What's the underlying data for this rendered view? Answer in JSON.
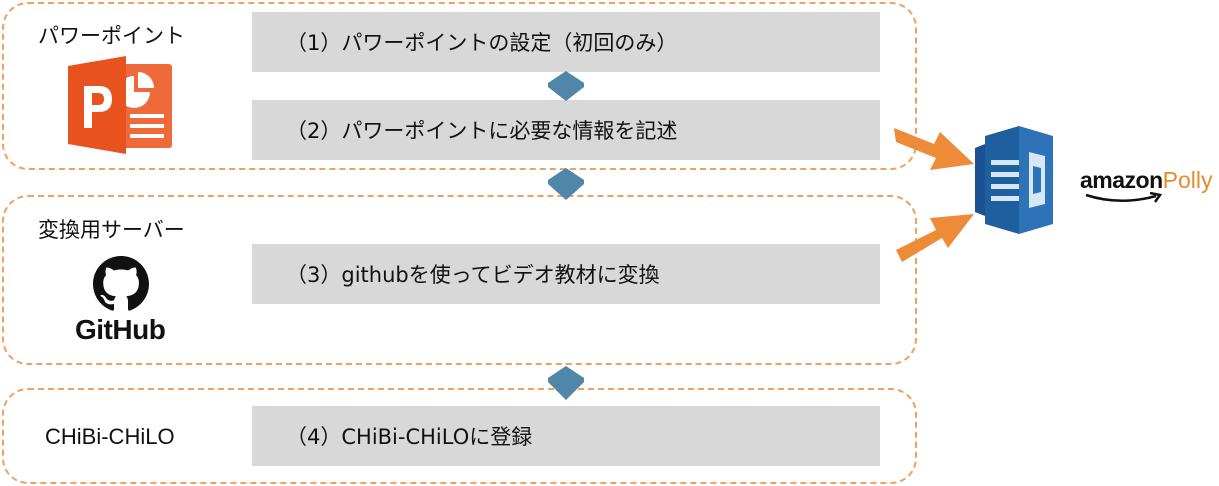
{
  "groups": [
    {
      "label": "パワーポイント",
      "icon": "powerpoint-logo-icon"
    },
    {
      "label": "変換用サーバー",
      "icon": "github-logo-icon",
      "logo_text": "GitHub"
    },
    {
      "label": "CHiBi-CHiLO"
    }
  ],
  "steps": [
    {
      "text": "（1）パワーポイントの設定（初回のみ）"
    },
    {
      "text": "（2）パワーポイントに必要な情報を記述"
    },
    {
      "text": "（3）githubを使ってビデオ教材に変換"
    },
    {
      "text": "（4）CHiBi-CHiLOに登録"
    }
  ],
  "service": {
    "brand": "amazon",
    "product": "Polly",
    "icon": "amazon-polly-logo-icon"
  },
  "colors": {
    "border_orange": "#f0a060",
    "arrow_orange": "#ee8b38",
    "step_gray": "#d8d8d8",
    "chevron_blue": "#4f86a9",
    "ppt_orange": "#ee5a24",
    "polly_blue": "#2e73b8",
    "polly_orange": "#e8892d"
  }
}
